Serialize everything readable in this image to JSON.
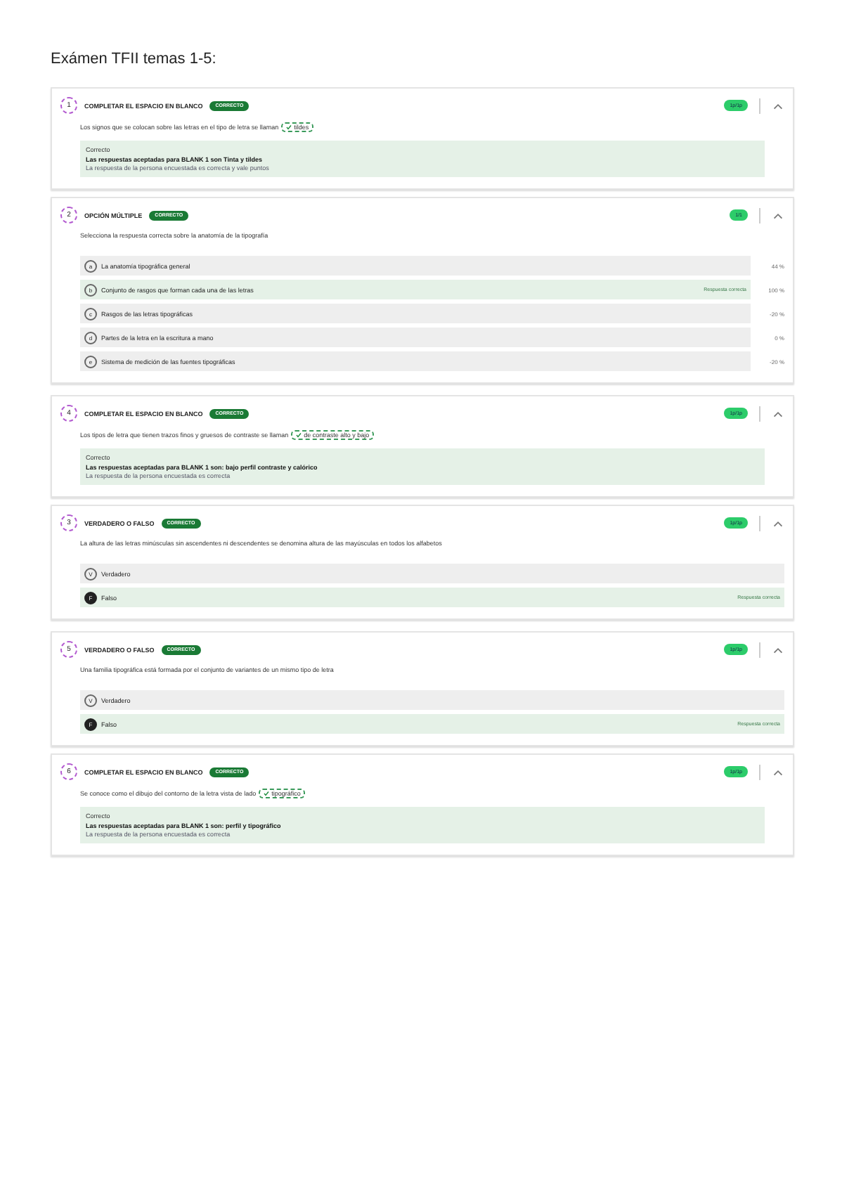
{
  "title": "Exámen TFII temas 1-5:",
  "questions": [
    {
      "number": "1",
      "type": "COMPLETAR EL ESPACIO EN BLANCO",
      "status": "CORRECTO",
      "score": "1p/1p",
      "expanded": true,
      "kind": "blank",
      "prompt": "Los signos que se colocan sobre las letras en el tipo de letra se llaman",
      "filled": "tildes",
      "answer_title": "Correcto",
      "answer_main": "Las respuestas aceptadas para BLANK 1 son Tinta y tildes",
      "answer_note": "La respuesta de la persona encuestada es correcta y vale puntos"
    },
    {
      "number": "2",
      "type": "OPCIÓN MÚLTIPLE",
      "status": "CORRECTO",
      "score": "1/1",
      "expanded": true,
      "kind": "choice",
      "prompt": "Selecciona la respuesta correcta sobre la anatomía de la tipografía",
      "options": [
        {
          "letter": "a",
          "text": "La anatomía tipográfica general",
          "correct": false,
          "selected": false,
          "percent": "44 %"
        },
        {
          "letter": "b",
          "text": "Conjunto de rasgos que forman cada una de las letras",
          "correct": true,
          "selected": false,
          "note": "Respuesta correcta",
          "percent": "100 %"
        },
        {
          "letter": "c",
          "text": "Rasgos de las letras tipográficas",
          "correct": false,
          "selected": false,
          "percent": "-20 %"
        },
        {
          "letter": "d",
          "text": "Partes de la letra en la escritura a mano",
          "correct": false,
          "selected": false,
          "percent": "0 %"
        },
        {
          "letter": "e",
          "text": "Sistema de medición de las fuentes tipográficas",
          "correct": false,
          "selected": false,
          "percent": "-20 %"
        }
      ]
    },
    {
      "number": "4",
      "type": "COMPLETAR EL ESPACIO EN BLANCO",
      "status": "CORRECTO",
      "score": "1p/1p",
      "expanded": true,
      "kind": "blank",
      "prompt": "Los tipos de letra que tienen trazos finos y gruesos de contraste se llaman",
      "filled": "de contraste alto y bajo",
      "answer_title": "Correcto",
      "answer_main": "Las respuestas aceptadas para BLANK 1 son: bajo perfil contraste y calórico",
      "answer_note": "La respuesta de la persona encuestada es correcta"
    },
    {
      "number": "3",
      "type": "VERDADERO O FALSO",
      "status": "CORRECTO",
      "score": "1p/1p",
      "expanded": true,
      "kind": "choice",
      "prompt": "La altura de las letras minúsculas sin ascendentes ni descendentes se denomina altura de las mayúsculas en todos los alfabetos",
      "options": [
        {
          "letter": "V",
          "text": "Verdadero",
          "correct": false,
          "selected": false
        },
        {
          "letter": "F",
          "text": "Falso",
          "correct": true,
          "selected": true,
          "note": "Respuesta correcta"
        }
      ]
    },
    {
      "number": "5",
      "type": "VERDADERO O FALSO",
      "status": "CORRECTO",
      "score": "1p/1p",
      "expanded": true,
      "kind": "choice",
      "prompt": "Una familia tipográfica está formada por el conjunto de variantes de un mismo tipo de letra",
      "options": [
        {
          "letter": "V",
          "text": "Verdadero",
          "correct": false,
          "selected": false
        },
        {
          "letter": "F",
          "text": "Falso",
          "correct": true,
          "selected": true,
          "note": "Respuesta correcta"
        }
      ]
    },
    {
      "number": "6",
      "type": "COMPLETAR EL ESPACIO EN BLANCO",
      "status": "CORRECTO",
      "score": "1p/1p",
      "expanded": true,
      "kind": "blank",
      "prompt": "Se conoce como el dibujo del contorno de la letra vista de lado",
      "filled": "tipográfico",
      "answer_title": "Correcto",
      "answer_main": "Las respuestas aceptadas para BLANK 1 son: perfil y tipográfico",
      "answer_note": "La respuesta de la persona encuestada es correcta"
    }
  ]
}
